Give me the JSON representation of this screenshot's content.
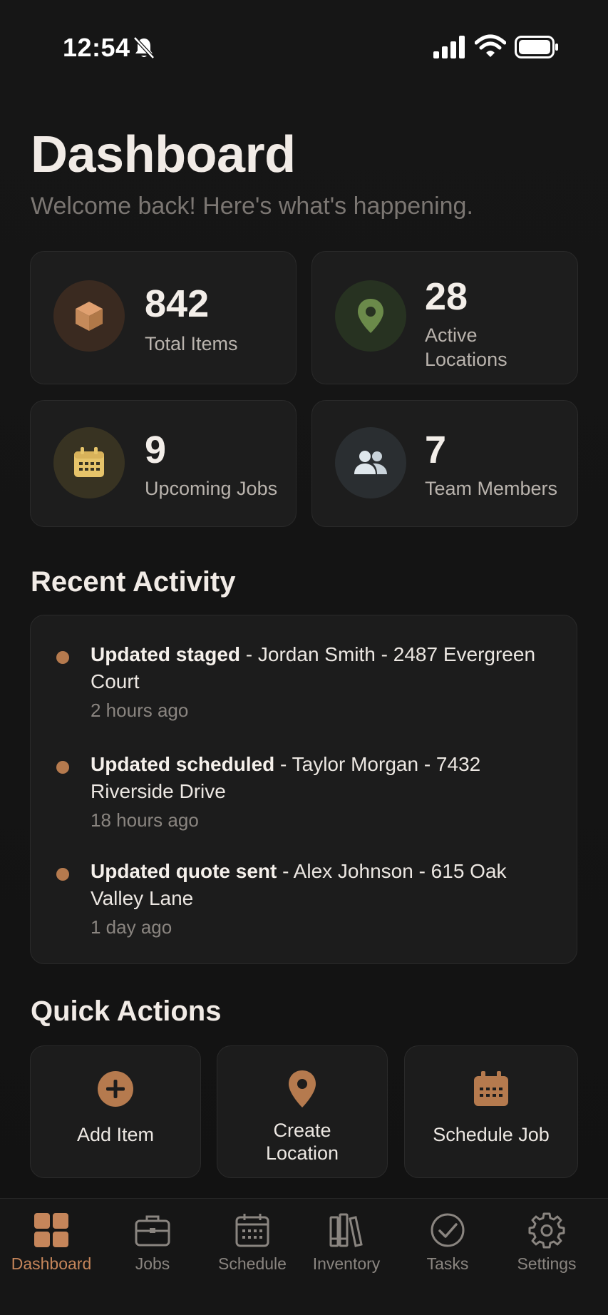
{
  "status_bar": {
    "time": "12:54"
  },
  "header": {
    "title": "Dashboard",
    "subtitle": "Welcome back! Here's what's happening."
  },
  "stats": [
    {
      "value": "842",
      "label": "Total Items",
      "icon": "box-icon",
      "color": "#c58a5a"
    },
    {
      "value": "28",
      "label": "Active Locations",
      "icon": "map-pin-icon",
      "color": "#6b8a4a"
    },
    {
      "value": "9",
      "label": "Upcoming Jobs",
      "icon": "calendar-icon",
      "color": "#e6c46a"
    },
    {
      "value": "7",
      "label": "Team Members",
      "icon": "users-icon",
      "color": "#b8c4cc"
    }
  ],
  "recent_activity": {
    "title": "Recent Activity",
    "items": [
      {
        "action": "Updated staged",
        "detail": " - Jordan Smith - 2487 Evergreen Court",
        "time": "2 hours ago"
      },
      {
        "action": "Updated scheduled",
        "detail": " - Taylor Morgan - 7432 Riverside Drive",
        "time": "18 hours ago"
      },
      {
        "action": "Updated quote sent",
        "detail": " - Alex Johnson - 615 Oak Valley Lane",
        "time": "1 day ago"
      }
    ]
  },
  "quick_actions": {
    "title": "Quick Actions",
    "items": [
      {
        "label": "Add Item",
        "icon": "plus-circle-icon"
      },
      {
        "label": "Create Location",
        "icon": "map-pin-icon"
      },
      {
        "label": "Schedule Job",
        "icon": "calendar-icon"
      }
    ]
  },
  "nav": {
    "items": [
      {
        "label": "Dashboard",
        "icon": "grid-icon",
        "active": true
      },
      {
        "label": "Jobs",
        "icon": "briefcase-icon"
      },
      {
        "label": "Schedule",
        "icon": "calendar-icon"
      },
      {
        "label": "Inventory",
        "icon": "books-icon"
      },
      {
        "label": "Tasks",
        "icon": "check-circle-icon"
      },
      {
        "label": "Settings",
        "icon": "gear-icon"
      }
    ]
  },
  "colors": {
    "accent": "#c5855a",
    "background": "#141414",
    "card": "#1d1d1d"
  }
}
